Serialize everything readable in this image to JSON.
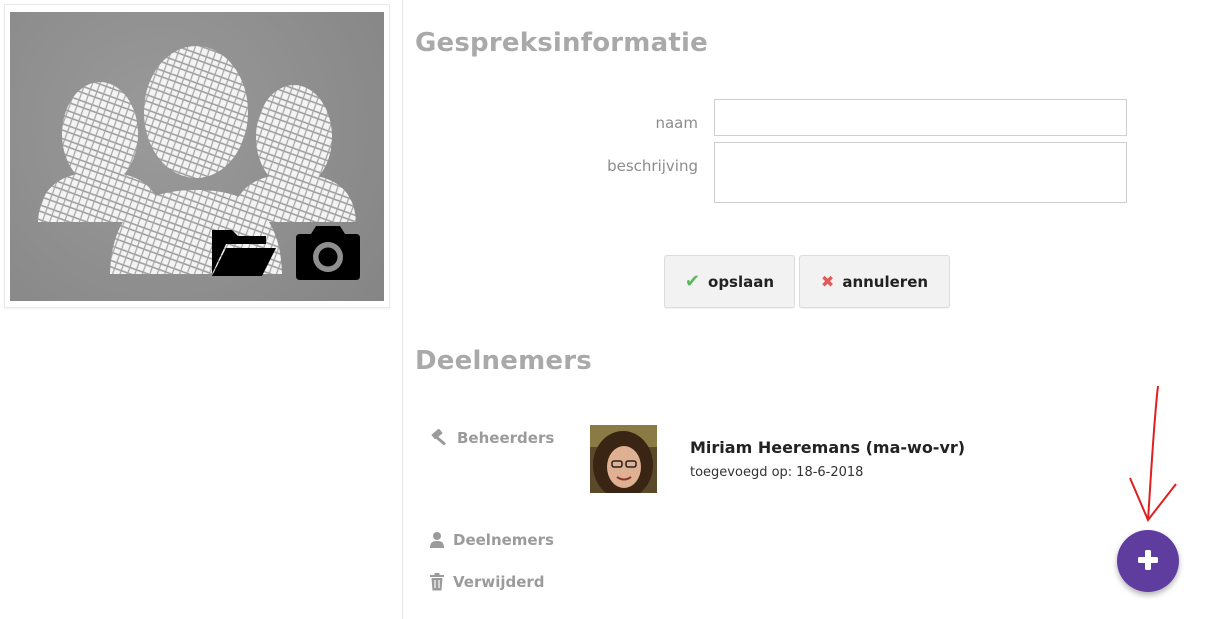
{
  "conversation_info": {
    "title": "Gespreksinformatie",
    "name_label": "naam",
    "name_value": "",
    "description_label": "beschrijving",
    "description_value": "",
    "save_label": "opslaan",
    "cancel_label": "annuleren"
  },
  "participants": {
    "title": "Deelnemers",
    "roles": {
      "admins": "Beheerders",
      "members": "Deelnemers",
      "deleted": "Verwijderd"
    },
    "admins_list": [
      {
        "name": "Miriam Heeremans (ma-wo-vr)",
        "added_label": "toegevoegd op:",
        "added_date": "18-6-2018"
      }
    ]
  },
  "photo": {
    "folder_icon": "folder-open-icon",
    "camera_icon": "camera-icon"
  },
  "fab": {
    "icon": "plus-icon"
  },
  "colors": {
    "fab": "#5e3d9f",
    "section_title": "#a9a9a9",
    "check": "#5cb85c",
    "cross": "#e05a5a",
    "annotation_arrow": "#e02020"
  }
}
